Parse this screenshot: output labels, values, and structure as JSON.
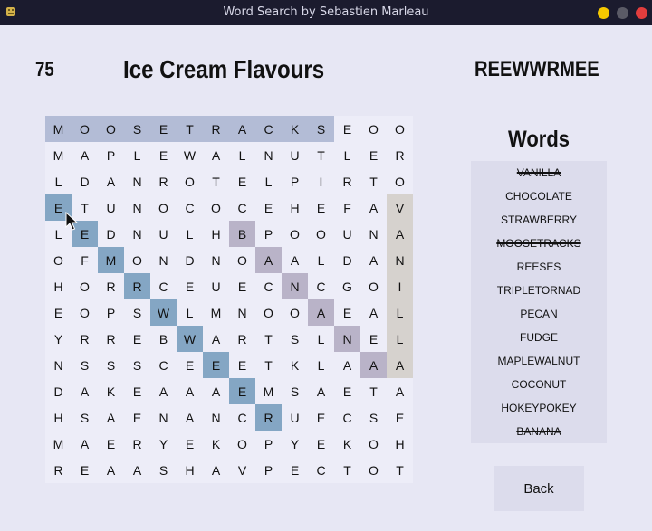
{
  "window": {
    "title": "Word Search by Sebastien Marleau"
  },
  "header": {
    "score": "75",
    "title": "Ice Cream Flavours",
    "current_selection": "REEWWRMEE"
  },
  "colors": {
    "selection_row": "#b3bcd6",
    "diagonal_found": "#84a6c4",
    "diagonal_active": "#b9b3c8",
    "column_highlight": "#d6d2ce",
    "cell_background": "#ededf8"
  },
  "grid": {
    "rows": [
      "MOOSETRACKSEOO",
      "MAPLEWALNUTLER",
      "LDANROTELPIRTO",
      "ETUNOCOCEHEFAV",
      "LEDNULHBPOOUNA",
      "OFMONDNOAALDAN",
      "HORRCEUECNCGOI",
      "EOPSWLMNOOAEAL",
      "YRREBWARTSLNEL",
      "NSSSCEEETKLAAA",
      "DAKEAAAEMSAETA",
      "HSAENANCRUECSE",
      "MAERYEKOPYEKOH",
      "REAASHAVPECTOT"
    ],
    "highlights": [
      {
        "cells": [
          [
            0,
            0
          ],
          [
            0,
            1
          ],
          [
            0,
            2
          ],
          [
            0,
            3
          ],
          [
            0,
            4
          ],
          [
            0,
            5
          ],
          [
            0,
            6
          ],
          [
            0,
            7
          ],
          [
            0,
            8
          ],
          [
            0,
            9
          ],
          [
            0,
            10
          ]
        ],
        "color": "selection_row"
      },
      {
        "cells": [
          [
            3,
            0
          ],
          [
            4,
            1
          ],
          [
            5,
            2
          ],
          [
            6,
            3
          ],
          [
            7,
            4
          ],
          [
            8,
            5
          ],
          [
            9,
            6
          ],
          [
            10,
            7
          ],
          [
            11,
            8
          ]
        ],
        "color": "diagonal_found"
      },
      {
        "cells": [
          [
            4,
            7
          ],
          [
            5,
            8
          ],
          [
            6,
            9
          ],
          [
            7,
            10
          ],
          [
            8,
            11
          ],
          [
            9,
            12
          ]
        ],
        "color": "diagonal_active"
      },
      {
        "cells": [
          [
            3,
            13
          ],
          [
            4,
            13
          ],
          [
            5,
            13
          ],
          [
            6,
            13
          ],
          [
            7,
            13
          ],
          [
            8,
            13
          ],
          [
            9,
            13
          ]
        ],
        "color": "column_highlight"
      }
    ]
  },
  "words_panel": {
    "heading": "Words",
    "words": [
      {
        "text": "VANILLA",
        "found": true
      },
      {
        "text": "CHOCOLATE",
        "found": false
      },
      {
        "text": "STRAWBERRY",
        "found": false
      },
      {
        "text": "MOOSETRACKS",
        "found": true
      },
      {
        "text": "REESES",
        "found": false
      },
      {
        "text": "TRIPLETORNAD",
        "found": false
      },
      {
        "text": "PECAN",
        "found": false
      },
      {
        "text": "FUDGE",
        "found": false
      },
      {
        "text": "MAPLEWALNUT",
        "found": false
      },
      {
        "text": "COCONUT",
        "found": false
      },
      {
        "text": "HOKEYPOKEY",
        "found": false
      },
      {
        "text": "BANANA",
        "found": true
      }
    ]
  },
  "back_button": {
    "label": "Back"
  },
  "icons": {
    "app": "app-icon",
    "cursor": "mouse-cursor-icon"
  }
}
